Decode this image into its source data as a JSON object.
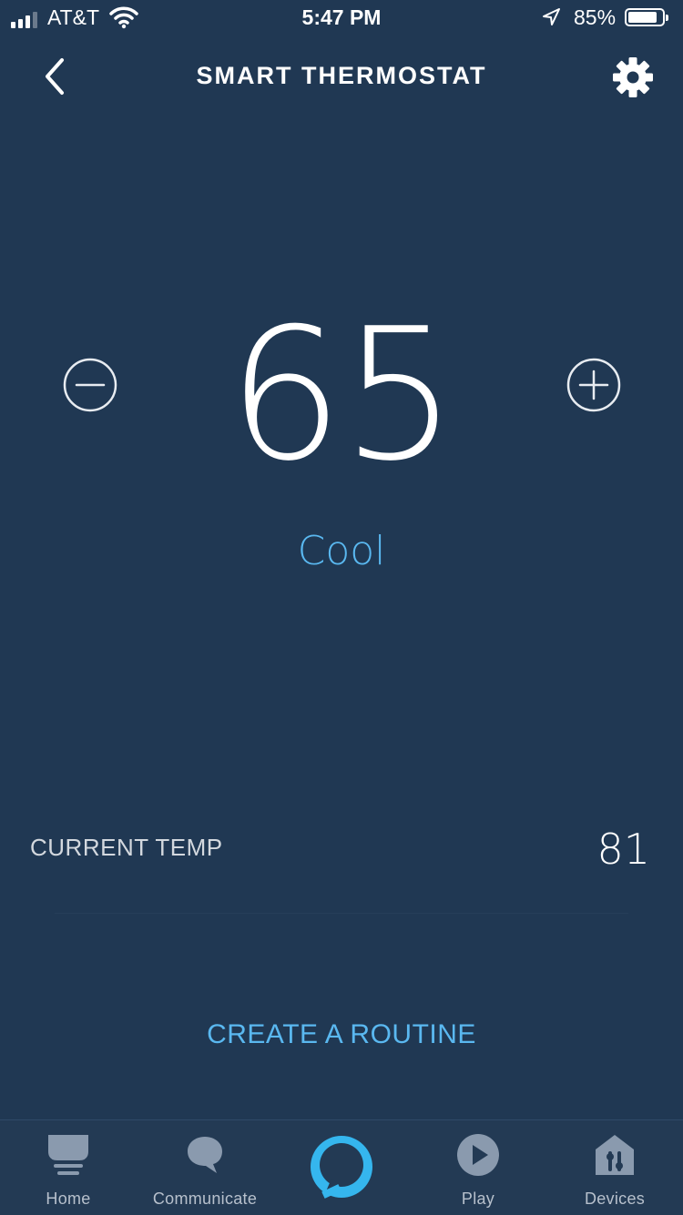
{
  "status_bar": {
    "carrier": "AT&T",
    "time": "5:47 PM",
    "battery_percent": "85%",
    "battery_level": 0.85
  },
  "header": {
    "title": "SMART THERMOSTAT",
    "back_icon": "chevron-left-icon",
    "settings_icon": "gear-icon"
  },
  "thermostat": {
    "setpoint": "65",
    "mode": "Cool",
    "current_temp_label": "CURRENT TEMP",
    "current_temp": "81"
  },
  "routine_link": "CREATE A ROUTINE",
  "tabs": [
    {
      "label": "Home",
      "icon": "home-icon"
    },
    {
      "label": "Communicate",
      "icon": "chat-bubble-icon"
    },
    {
      "label": "",
      "icon": "alexa-icon"
    },
    {
      "label": "Play",
      "icon": "play-icon"
    },
    {
      "label": "Devices",
      "icon": "devices-icon"
    }
  ],
  "colors": {
    "background": "#203853",
    "accent": "#5ab8f0",
    "tab_bar": "#233a54",
    "tab_icon": "#8a9aae"
  }
}
